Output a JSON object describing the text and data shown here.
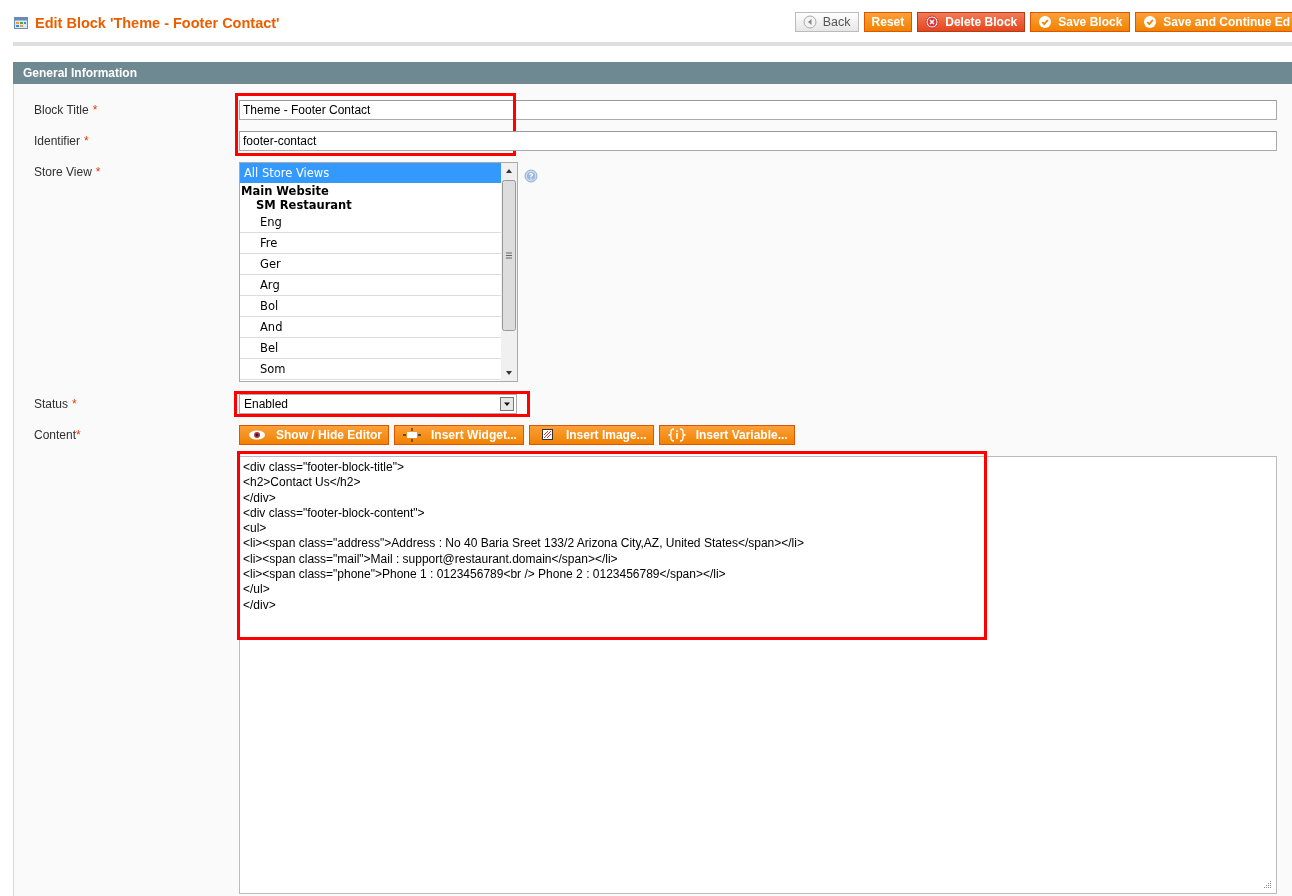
{
  "page": {
    "title": "Edit Block 'Theme - Footer Contact'"
  },
  "actions": [
    {
      "label": "Back",
      "kind": "back"
    },
    {
      "label": "Reset",
      "kind": "plain"
    },
    {
      "label": "Delete Block",
      "kind": "delete"
    },
    {
      "label": "Save Block",
      "kind": "save"
    },
    {
      "label": "Save and Continue Ed",
      "kind": "save"
    }
  ],
  "section": {
    "title": "General Information"
  },
  "fields": [
    {
      "kind": "text",
      "label": "Block Title",
      "required_mark": "*",
      "value": "Theme - Footer Contact",
      "highlighted": true
    },
    {
      "kind": "text",
      "label": "Identifier",
      "required_mark": "*",
      "value": "footer-contact",
      "highlighted": true
    },
    {
      "kind": "multiselect",
      "label": "Store View",
      "required_mark": "*",
      "highlighted": false,
      "options": [
        {
          "kind": "option",
          "label": "All Store Views",
          "selected": true
        },
        {
          "kind": "group",
          "label": "Main Website",
          "selected": false
        },
        {
          "kind": "subgroup",
          "label": "SM Restaurant",
          "selected": false
        },
        {
          "kind": "store",
          "label": "Eng",
          "selected": false
        },
        {
          "kind": "store",
          "label": "Fre",
          "selected": false
        },
        {
          "kind": "store",
          "label": "Ger",
          "selected": false
        },
        {
          "kind": "store",
          "label": "Arg",
          "selected": false
        },
        {
          "kind": "store",
          "label": "Bol",
          "selected": false
        },
        {
          "kind": "store",
          "label": "And",
          "selected": false
        },
        {
          "kind": "store",
          "label": "Bel",
          "selected": false
        },
        {
          "kind": "store",
          "label": "Som",
          "selected": false
        }
      ]
    },
    {
      "kind": "select",
      "label": "Status",
      "required_mark": "*",
      "value": "Enabled",
      "highlighted": true
    },
    {
      "kind": "editor",
      "label": "Content",
      "required_mark": "*",
      "highlighted": true,
      "buttons": [
        {
          "label": "Show / Hide Editor"
        },
        {
          "label": "Insert Widget..."
        },
        {
          "label": "Insert Image..."
        },
        {
          "label": "Insert Variable..."
        }
      ],
      "value": "<div class=\"footer-block-title\">\n<h2>Contact Us</h2>\n</div>\n<div class=\"footer-block-content\">\n<ul>\n<li><span class=\"address\">Address : No 40 Baria Sreet 133/2 Arizona City,AZ, United States</span></li>\n<li><span class=\"mail\">Mail : support@restaurant.domain</span></li>\n<li><span class=\"phone\">Phone 1 : 0123456789<br /> Phone 2 : 0123456789</span></li>\n</ul>\n</div>"
    }
  ]
}
